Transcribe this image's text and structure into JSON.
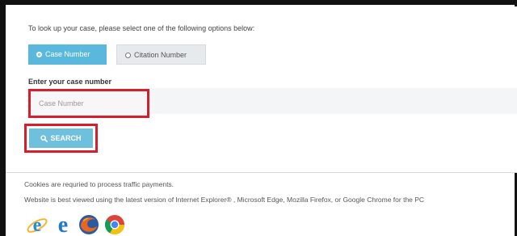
{
  "page": {
    "intro_text": "To look up your case, please select one of the following options below:"
  },
  "lookup_options": [
    {
      "label": "Case Number",
      "selected": true
    },
    {
      "label": "Citation Number",
      "selected": false
    }
  ],
  "case_field": {
    "label": "Enter your case number",
    "placeholder": "Case Number",
    "value": ""
  },
  "search_button": {
    "label": "SEARCH"
  },
  "footer": {
    "cookies_note": "Cookies are requried to process traffic payments.",
    "browser_note": "Website is best viewed using the latest version of Internet Explorer® , Microsoft Edge, Mozilla Firefox, or Google Chrome for the PC"
  },
  "browser_icons": [
    "internet-explorer-icon",
    "edge-icon",
    "firefox-icon",
    "chrome-icon"
  ],
  "colors": {
    "accent": "#5bb8dd",
    "button": "#6fc0dd",
    "highlight_border": "#d81e2c"
  }
}
